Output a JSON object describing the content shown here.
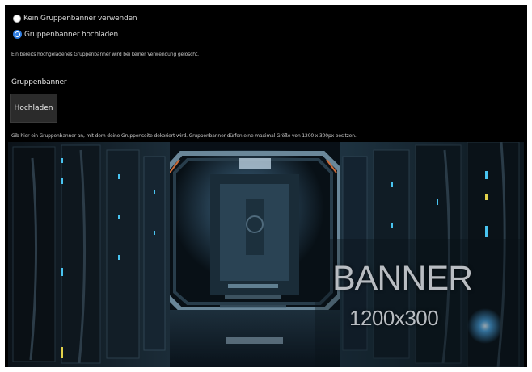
{
  "options": {
    "no_banner": {
      "label": "Kein Gruppenbanner verwenden",
      "selected": false
    },
    "upload_banner": {
      "label": "Gruppenbanner hochladen",
      "selected": true
    }
  },
  "delete_hint": "Ein bereits hochgeladenes Gruppenbanner wird bei keiner Verwendung gelöscht.",
  "section": {
    "label": "Gruppenbanner",
    "upload_button": "Hochladen"
  },
  "size_hint": "Gib hier ein Gruppenbanner an, mit dem deine Gruppenseite dekoriert wird. Gruppenbanner dürfen eine maximal Größe von 1200 x 300px besitzen.",
  "banner": {
    "title": "BANNER",
    "size": "1200x300"
  },
  "colors": {
    "background": "#000000",
    "radio_accent": "#2f7de1",
    "button_bg": "#2b2b2b"
  }
}
